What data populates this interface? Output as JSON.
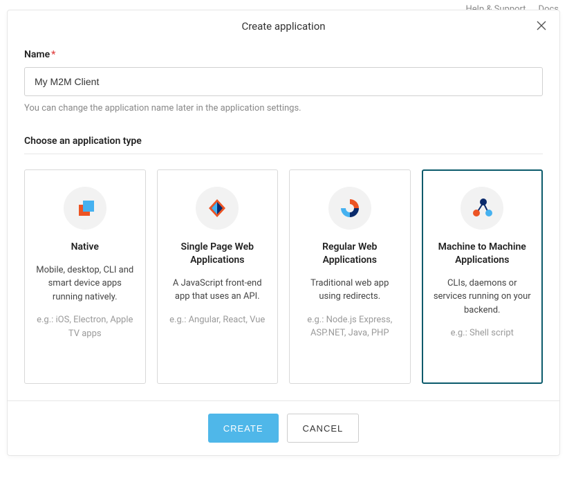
{
  "background": {
    "help": "Help & Support",
    "docs": "Docs"
  },
  "modal": {
    "title": "Create application",
    "nameLabel": "Name",
    "nameRequired": "*",
    "nameValue": "My M2M Client",
    "nameHelper": "You can change the application name later in the application settings.",
    "typeLabel": "Choose an application type",
    "cards": [
      {
        "title": "Native",
        "desc": "Mobile, desktop, CLI and smart device apps running natively.",
        "eg": "e.g.: iOS, Electron, Apple TV apps"
      },
      {
        "title": "Single Page Web Applications",
        "desc": "A JavaScript front-end app that uses an API.",
        "eg": "e.g.: Angular, React, Vue"
      },
      {
        "title": "Regular Web Applications",
        "desc": "Traditional web app using redirects.",
        "eg": "e.g.: Node.js Express, ASP.NET, Java, PHP"
      },
      {
        "title": "Machine to Machine Applications",
        "desc": "CLIs, daemons or services running on your backend.",
        "eg": "e.g.: Shell script"
      }
    ],
    "createLabel": "CREATE",
    "cancelLabel": "CANCEL"
  }
}
